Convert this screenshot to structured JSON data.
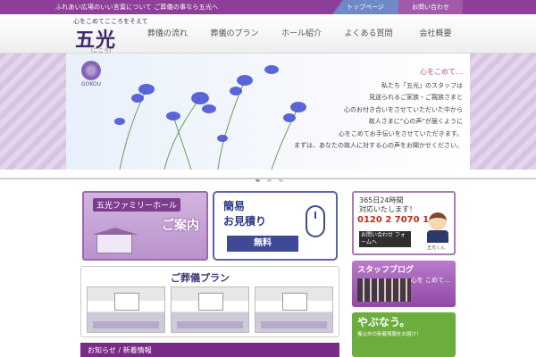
{
  "topbar": {
    "tagline": "ふれあい広場のいい言葉について ご葬儀の事なら五光へ",
    "links": {
      "home": "トップページ",
      "contact": "お問い合わせ"
    }
  },
  "header": {
    "slogan": "心をこめてこころをそえて",
    "logo": "五光",
    "logo_reading": "（ごこう）",
    "nav": [
      "葬儀の流れ",
      "葬儀のプラン",
      "ホール紹介",
      "よくある質問",
      "会社概要"
    ]
  },
  "hero": {
    "badge": "GOKOU",
    "heading": "心をこめて…",
    "lines": [
      "私たち「五光」のスタッフは",
      "見送られるご家族・ご親族さまと",
      "心のお付き合いをさせていただいた中から",
      "故人さまに“心の声”が届くように",
      "心をこめてお手伝いをさせていただきます。",
      "まずは、あなたの故人に対する心の声をお聞かせください。"
    ],
    "slides": 3,
    "active_slide": 1
  },
  "cards": {
    "hall": {
      "title": "五光ファミリーホール",
      "guide": "ご案内"
    },
    "estimate": {
      "line1": "簡易",
      "line2": "お見積り",
      "free": "無料"
    },
    "hotline": {
      "line1": "365日24時間",
      "line2": "対応いたします！",
      "tel": "0120 2 7070 1",
      "inquiry": "お問い合わせ フォームへ",
      "mascot": "五光くん"
    },
    "blog": {
      "title": "スタッフブログ",
      "caption": "心を こめて…"
    },
    "yabu": {
      "title": "やぶなう。",
      "sub": "養父市の新着情報をお届け！"
    },
    "plans": {
      "title": "ご葬儀プラン"
    },
    "news": {
      "title": "お知らせ / 新着情報"
    }
  },
  "colors": {
    "brand_purple": "#8e3f97",
    "nav_blue": "#6f89c4",
    "green": "#6cae3d",
    "tel_red": "#c3271a"
  }
}
